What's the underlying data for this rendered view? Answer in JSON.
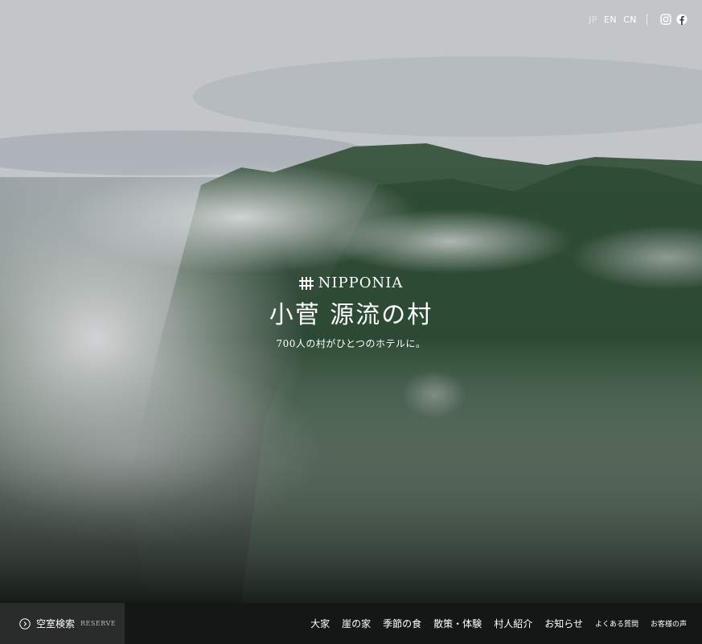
{
  "header": {
    "languages": [
      "JP",
      "EN",
      "CN"
    ],
    "active_language": "JP",
    "social": [
      "instagram-icon",
      "facebook-icon"
    ]
  },
  "brand": {
    "logo_text": "NIPPONIA",
    "title": "小菅 源流の村",
    "tagline": "700人の村がひとつのホテルに。"
  },
  "footer": {
    "reserve": {
      "label": "空室検索",
      "sublabel": "RESERVE",
      "icon": "chevron-circle-icon"
    },
    "nav": [
      "大家",
      "崖の家",
      "季節の食",
      "散策・体験",
      "村人紹介",
      "お知らせ",
      "よくある質問",
      "お客様の声"
    ]
  },
  "colors": {
    "bottom_bar": "#151716",
    "reserve_bg": "#2a2c2b",
    "text": "#ffffff"
  }
}
